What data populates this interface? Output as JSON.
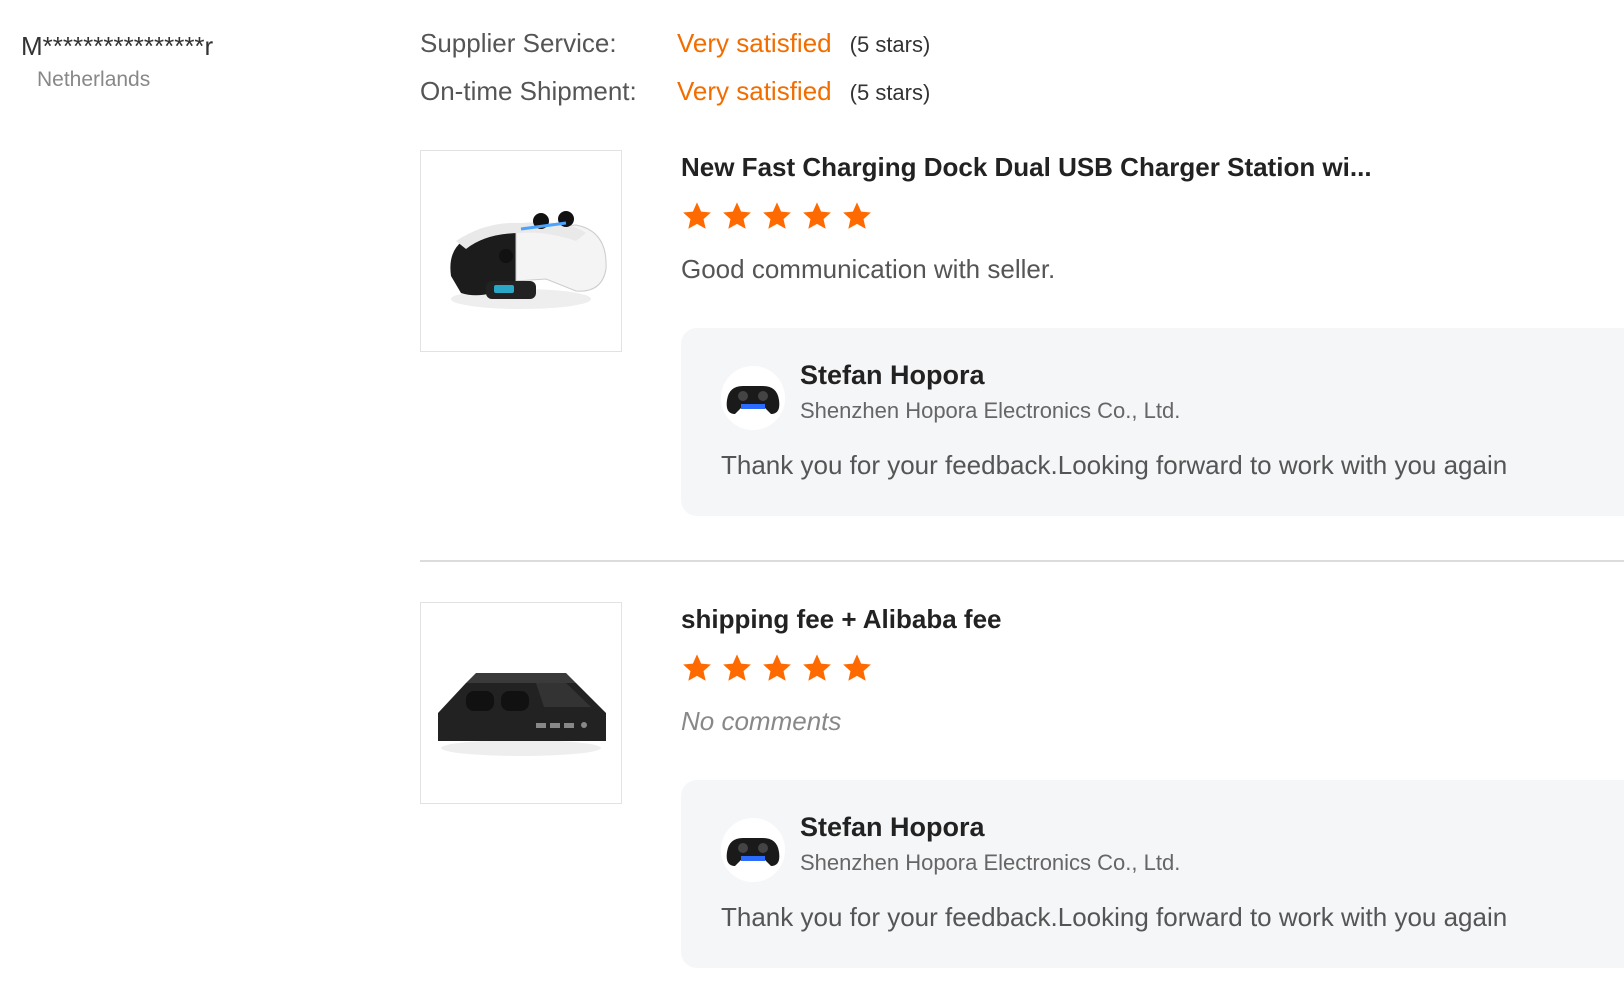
{
  "reviewer": {
    "name": "M****************r",
    "country": "Netherlands"
  },
  "metrics": [
    {
      "label": "Supplier Service:",
      "value": "Very satisfied",
      "stars": "(5 stars)"
    },
    {
      "label": "On-time Shipment:",
      "value": "Very satisfied",
      "stars": "(5 stars)"
    }
  ],
  "reviews": [
    {
      "title": "New Fast Charging Dock Dual USB Charger Station wi...",
      "rating": 5,
      "comment": "Good communication with seller.",
      "image_icon": "controller-charging-dock",
      "reply": {
        "name": "Stefan Hopora",
        "company": "Shenzhen Hopora Electronics Co., Ltd.",
        "text": "Thank you for your feedback.Looking forward to work with you again"
      }
    },
    {
      "title": "shipping fee + Alibaba fee",
      "rating": 5,
      "comment": "No comments",
      "image_icon": "console-stand",
      "reply": {
        "name": "Stefan Hopora",
        "company": "Shenzhen Hopora Electronics Co., Ltd.",
        "text": "Thank you for your feedback.Looking forward to work with you again"
      }
    }
  ],
  "colors": {
    "accent": "#f26d00",
    "star": "#ff6a00",
    "reply_bg": "#f5f6f8"
  }
}
